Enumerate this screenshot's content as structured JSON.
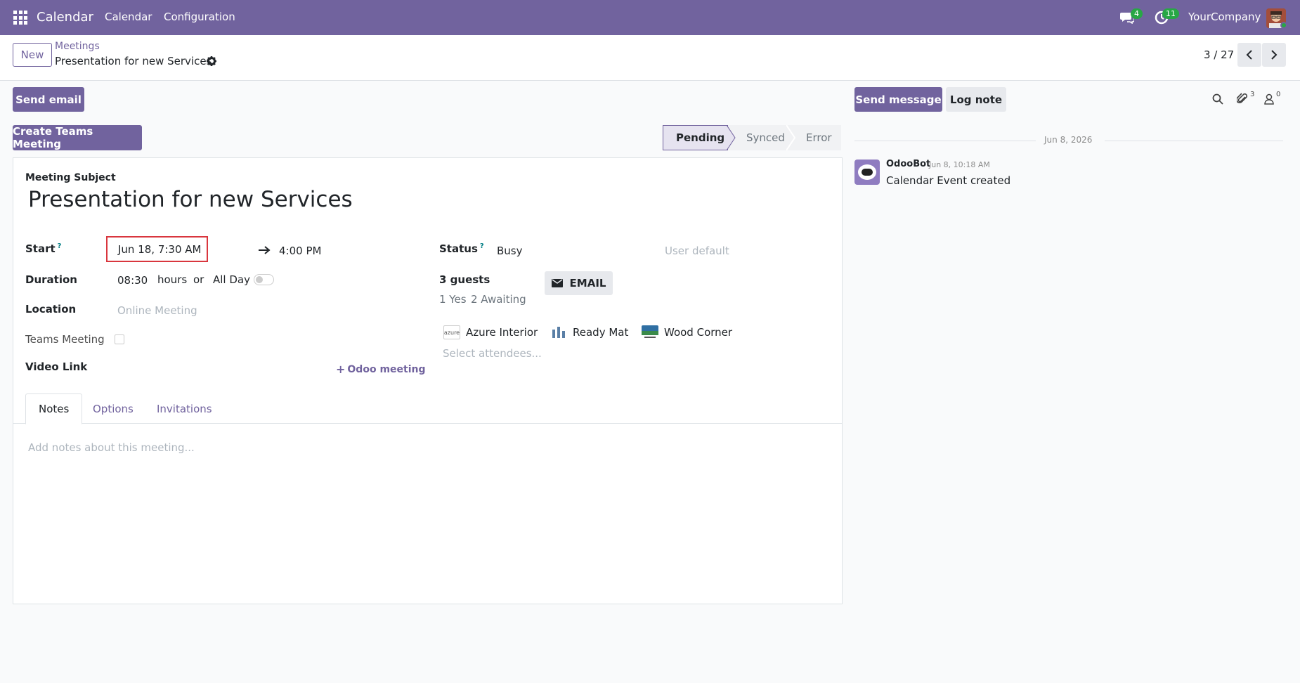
{
  "navbar": {
    "app_name": "Calendar",
    "menu": [
      "Calendar",
      "Configuration"
    ],
    "messages_badge": "4",
    "activities_badge": "11",
    "company": "YourCompany"
  },
  "control": {
    "new_label": "New",
    "breadcrumb_parent": "Meetings",
    "breadcrumb_current": "Presentation for new Services",
    "pager": "3 / 27"
  },
  "actions": {
    "send_email": "Send email",
    "create_teams": "Create Teams Meeting"
  },
  "statusbar": {
    "stages": [
      "Pending",
      "Synced",
      "Error"
    ],
    "active": "Pending"
  },
  "form": {
    "subject_label": "Meeting Subject",
    "subject": "Presentation for new Services",
    "start_label": "Start",
    "start_help": "?",
    "start_value": "Jun 18, 7:30 AM",
    "end_value": "4:00 PM",
    "duration_label": "Duration",
    "duration_value": "08:30",
    "hours_text": "hours",
    "or_text": "or",
    "allday_text": "All Day",
    "location_label": "Location",
    "location_placeholder": "Online Meeting",
    "teams_label": "Teams Meeting",
    "video_label": "Video Link",
    "odoo_meeting": "Odoo meeting",
    "status_label": "Status",
    "status_help": "?",
    "status_value": "Busy",
    "privacy_placeholder": "User default",
    "guests_label": "3 guests",
    "guests_yes": "1 Yes",
    "guests_awaiting": "2 Awaiting",
    "email_button": "EMAIL",
    "attendees": [
      {
        "name": "Azure Interior",
        "logo_text": "azure"
      },
      {
        "name": "Ready Mat",
        "logo_text": ""
      },
      {
        "name": "Wood Corner",
        "logo_text": ""
      }
    ],
    "attendees_placeholder": "Select attendees..."
  },
  "tabs": [
    "Notes",
    "Options",
    "Invitations"
  ],
  "notes_placeholder": "Add notes about this meeting...",
  "chatter": {
    "send_message": "Send message",
    "log_note": "Log note",
    "attachments_count": "3",
    "followers_count": "0",
    "date_separator": "Jun 8, 2026",
    "message_author": "OdooBot",
    "message_time": "Jun 8, 10:18 AM",
    "message_body": "Calendar Event created"
  },
  "colors": {
    "brand": "#71639e",
    "badge": "#28a745",
    "highlight_border": "#d9363e"
  }
}
